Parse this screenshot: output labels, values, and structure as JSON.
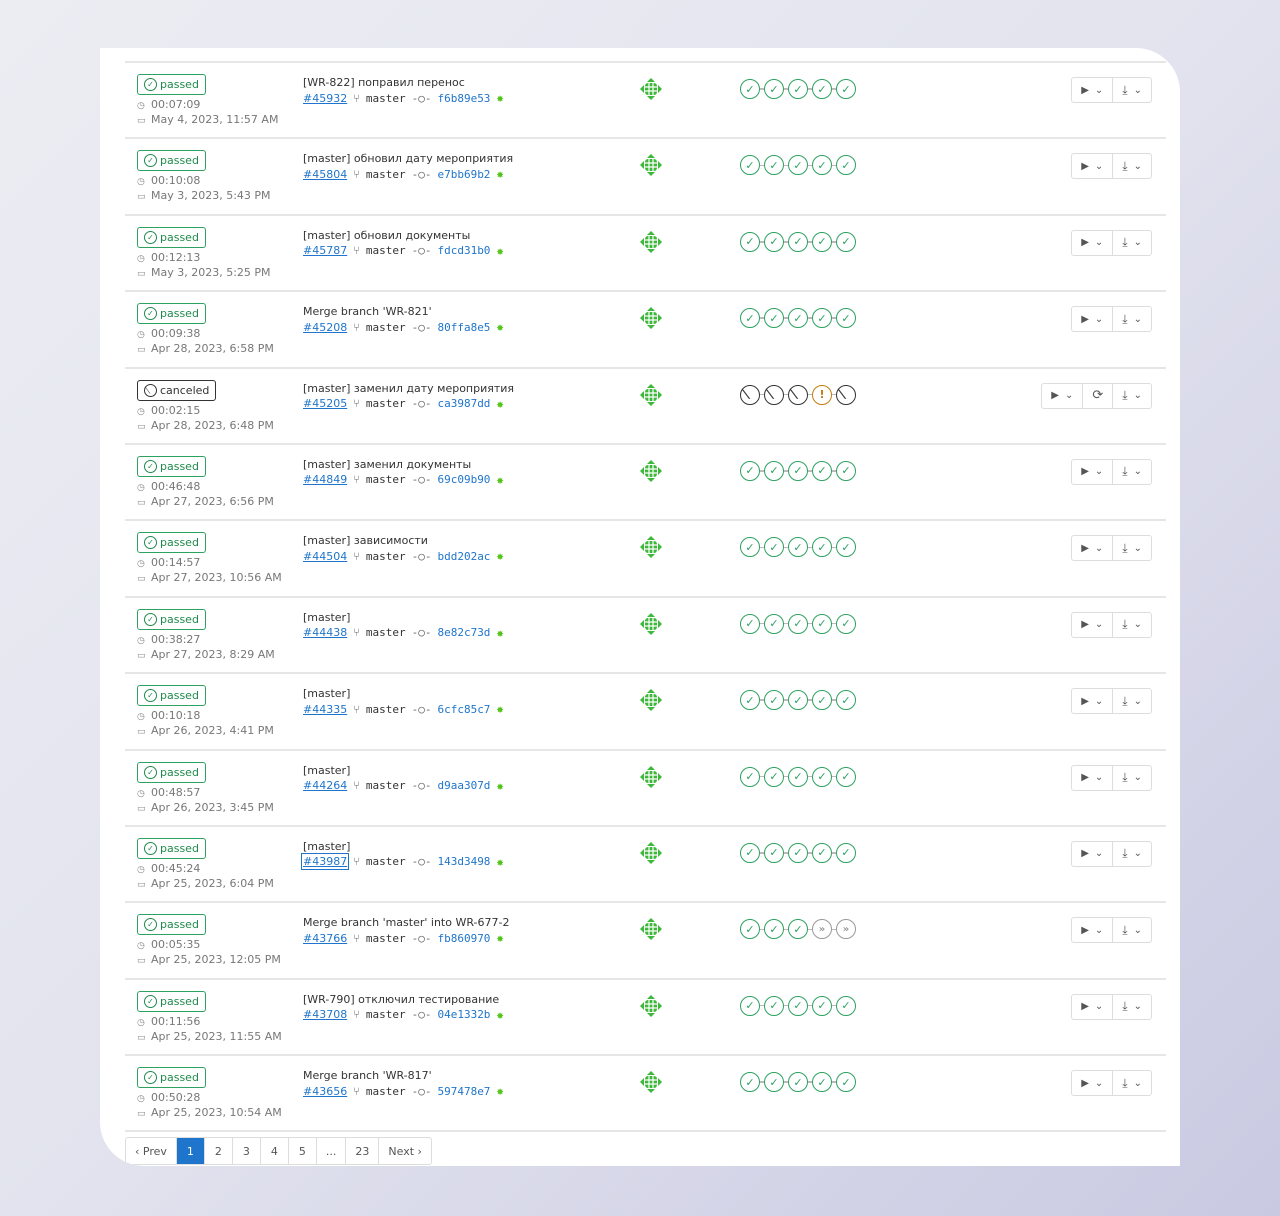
{
  "rows": [
    {
      "status": "passed",
      "duration": "00:07:09",
      "date": "May 4, 2023, 11:57 AM",
      "title": "[WR-822] поправил перенос",
      "id": "#45932",
      "branch": "master",
      "sha": "f6b89e53",
      "stages": [
        "success",
        "success",
        "success",
        "success",
        "success"
      ],
      "retry": false
    },
    {
      "status": "passed",
      "duration": "00:10:08",
      "date": "May 3, 2023, 5:43 PM",
      "title": "[master] обновил дату мероприятия",
      "id": "#45804",
      "branch": "master",
      "sha": "e7bb69b2",
      "stages": [
        "success",
        "success",
        "success",
        "success",
        "success"
      ],
      "retry": false
    },
    {
      "status": "passed",
      "duration": "00:12:13",
      "date": "May 3, 2023, 5:25 PM",
      "title": "[master] обновил документы",
      "id": "#45787",
      "branch": "master",
      "sha": "fdcd31b0",
      "stages": [
        "success",
        "success",
        "success",
        "success",
        "success"
      ],
      "retry": false
    },
    {
      "status": "passed",
      "duration": "00:09:38",
      "date": "Apr 28, 2023, 6:58 PM",
      "title": "Merge branch 'WR-821'",
      "id": "#45208",
      "branch": "master",
      "sha": "80ffa8e5",
      "stages": [
        "success",
        "success",
        "success",
        "success",
        "success"
      ],
      "retry": false
    },
    {
      "status": "canceled",
      "duration": "00:02:15",
      "date": "Apr 28, 2023, 6:48 PM",
      "title": "[master] заменил дату мероприятия",
      "id": "#45205",
      "branch": "master",
      "sha": "ca3987dd",
      "stages": [
        "canceled",
        "canceled",
        "canceled",
        "warning",
        "canceled"
      ],
      "retry": true
    },
    {
      "status": "passed",
      "duration": "00:46:48",
      "date": "Apr 27, 2023, 6:56 PM",
      "title": "[master] заменил документы",
      "id": "#44849",
      "branch": "master",
      "sha": "69c09b90",
      "stages": [
        "success",
        "success",
        "success",
        "success",
        "success"
      ],
      "retry": false
    },
    {
      "status": "passed",
      "duration": "00:14:57",
      "date": "Apr 27, 2023, 10:56 AM",
      "title": "[master] зависимости",
      "id": "#44504",
      "branch": "master",
      "sha": "bdd202ac",
      "stages": [
        "success",
        "success",
        "success",
        "success",
        "success"
      ],
      "retry": false
    },
    {
      "status": "passed",
      "duration": "00:38:27",
      "date": "Apr 27, 2023, 8:29 AM",
      "title": "[master]",
      "id": "#44438",
      "branch": "master",
      "sha": "8e82c73d",
      "stages": [
        "success",
        "success",
        "success",
        "success",
        "success"
      ],
      "retry": false
    },
    {
      "status": "passed",
      "duration": "00:10:18",
      "date": "Apr 26, 2023, 4:41 PM",
      "title": "[master]",
      "id": "#44335",
      "branch": "master",
      "sha": "6cfc85c7",
      "stages": [
        "success",
        "success",
        "success",
        "success",
        "success"
      ],
      "retry": false
    },
    {
      "status": "passed",
      "duration": "00:48:57",
      "date": "Apr 26, 2023, 3:45 PM",
      "title": "[master]",
      "id": "#44264",
      "branch": "master",
      "sha": "d9aa307d",
      "stages": [
        "success",
        "success",
        "success",
        "success",
        "success"
      ],
      "retry": false
    },
    {
      "status": "passed",
      "duration": "00:45:24",
      "date": "Apr 25, 2023, 6:04 PM",
      "title": "[master]",
      "id": "#43987",
      "branch": "master",
      "sha": "143d3498",
      "stages": [
        "success",
        "success",
        "success",
        "success",
        "success"
      ],
      "retry": false,
      "focused": true
    },
    {
      "status": "passed",
      "duration": "00:05:35",
      "date": "Apr 25, 2023, 12:05 PM",
      "title": "Merge branch 'master' into WR-677-2",
      "id": "#43766",
      "branch": "master",
      "sha": "fb860970",
      "stages": [
        "success",
        "success",
        "success",
        "skipped",
        "skipped"
      ],
      "retry": false
    },
    {
      "status": "passed",
      "duration": "00:11:56",
      "date": "Apr 25, 2023, 11:55 AM",
      "title": "[WR-790] отключил тестирование",
      "id": "#43708",
      "branch": "master",
      "sha": "04e1332b",
      "stages": [
        "success",
        "success",
        "success",
        "success",
        "success"
      ],
      "retry": false
    },
    {
      "status": "passed",
      "duration": "00:50:28",
      "date": "Apr 25, 2023, 10:54 AM",
      "title": "Merge branch 'WR-817'",
      "id": "#43656",
      "branch": "master",
      "sha": "597478e7",
      "stages": [
        "success",
        "success",
        "success",
        "success",
        "success"
      ],
      "retry": false
    }
  ],
  "pagination": {
    "prev": "‹ Prev",
    "pages": [
      "1",
      "2",
      "3",
      "4",
      "5",
      "...",
      "23"
    ],
    "current": "1",
    "next": "Next ›"
  }
}
